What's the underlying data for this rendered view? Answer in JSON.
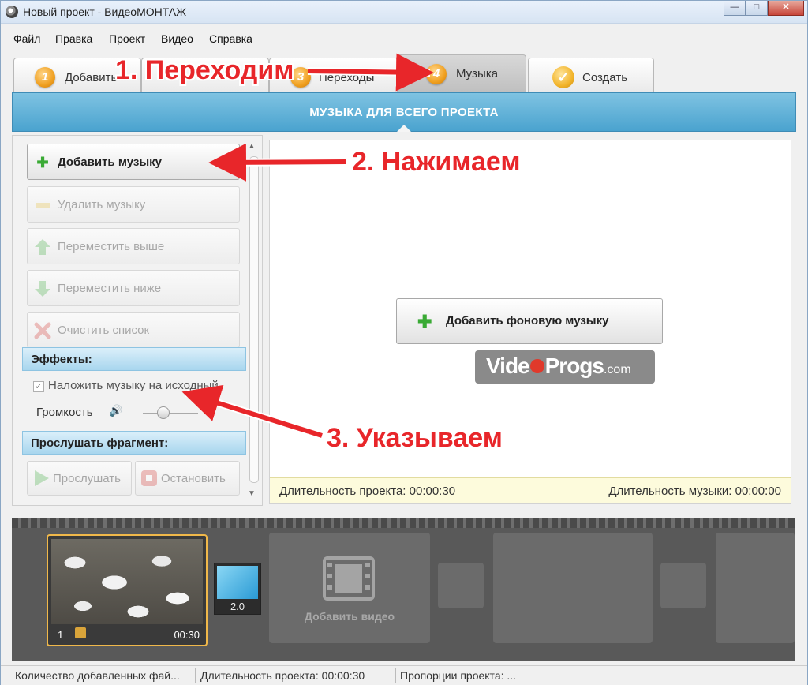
{
  "window": {
    "title": "Новый проект - ВидеоМОНТАЖ"
  },
  "menu": [
    "Файл",
    "Правка",
    "Проект",
    "Видео",
    "Справка"
  ],
  "tabs": [
    {
      "num": "1",
      "label": "Добавить"
    },
    {
      "num": "3",
      "label": "Переходы"
    },
    {
      "num": "4",
      "label": "Музыка",
      "active": true
    },
    {
      "label": "Создать",
      "icon": "check-icon"
    }
  ],
  "section": {
    "title": "МУЗЫКА ДЛЯ ВСЕГО ПРОЕКТА"
  },
  "left": {
    "add_music": "Добавить музыку",
    "remove_music": "Удалить музыку",
    "move_up": "Переместить выше",
    "move_down": "Переместить ниже",
    "clear_list": "Очистить список",
    "effects_header": "Эффекты:",
    "overlay_checkbox": "Наложить музыку на исходный",
    "volume_label": "Громкость",
    "volume_level": 0.35,
    "preview_header": "Прослушать фрагмент:",
    "play": "Прослушать",
    "stop": "Остановить"
  },
  "main": {
    "add_bg_music": "Добавить фоновую музыку",
    "watermark_a": "Vide",
    "watermark_b": "Progs",
    "watermark_c": ".com",
    "project_duration": "Длительность проекта: 00:00:30",
    "music_duration": "Длительность музыки: 00:00:00"
  },
  "timeline": {
    "clip_index": "1",
    "clip_duration": "00:30",
    "transition_value": "2.0",
    "add_video": "Добавить видео"
  },
  "status": {
    "files": "Количество добавленных фай...",
    "duration": "Длительность проекта:  00:00:30",
    "ratio": "Пропорции проекта:  ..."
  },
  "annotations": {
    "step1": "1. Переходим",
    "step2": "2. Нажимаем",
    "step3": "3. Указываем",
    "color": "#e8262a"
  }
}
